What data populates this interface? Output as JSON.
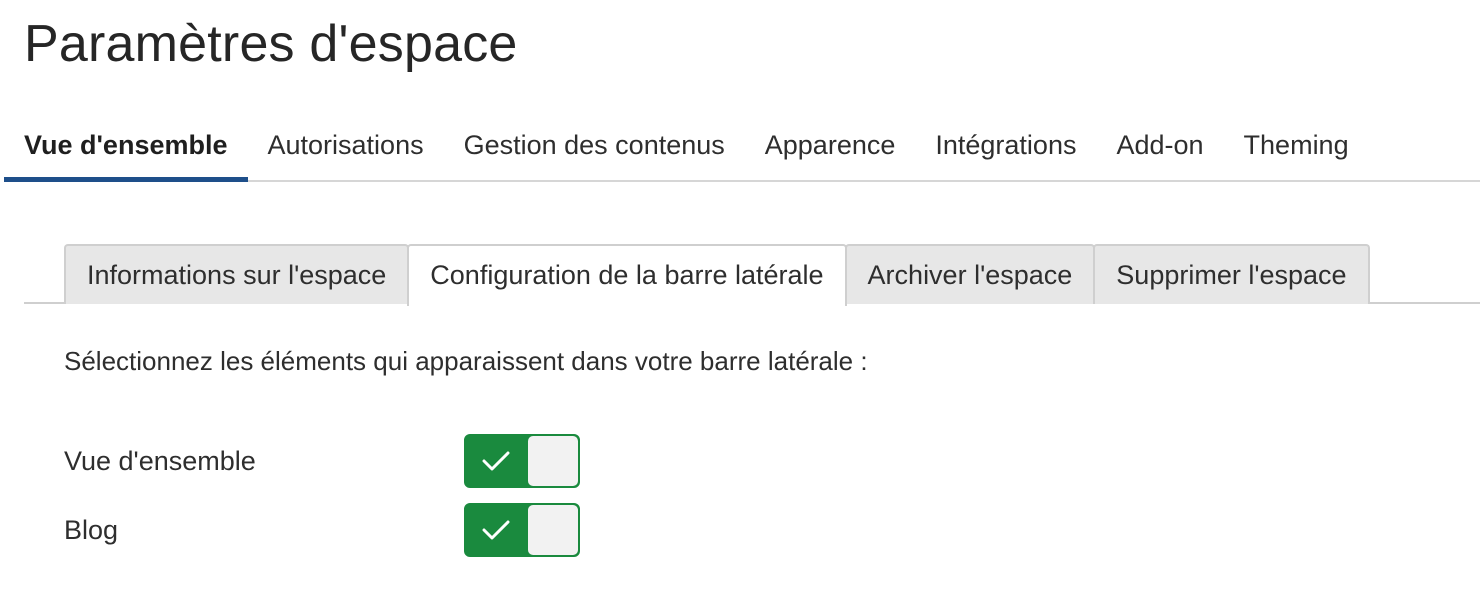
{
  "page": {
    "title": "Paramètres d'espace"
  },
  "top_tabs": [
    {
      "label": "Vue d'ensemble",
      "active": true
    },
    {
      "label": "Autorisations",
      "active": false
    },
    {
      "label": "Gestion des contenus",
      "active": false
    },
    {
      "label": "Apparence",
      "active": false
    },
    {
      "label": "Intégrations",
      "active": false
    },
    {
      "label": "Add-on",
      "active": false
    },
    {
      "label": "Theming",
      "active": false
    }
  ],
  "sub_tabs": [
    {
      "label": "Informations sur l'espace",
      "active": false
    },
    {
      "label": "Configuration de la barre latérale",
      "active": true
    },
    {
      "label": "Archiver l'espace",
      "active": false
    },
    {
      "label": "Supprimer l'espace",
      "active": false
    }
  ],
  "sidebar_config": {
    "instructions": "Sélectionnez les éléments qui apparaissent dans votre barre latérale :",
    "items": [
      {
        "label": "Vue d'ensemble",
        "enabled": true,
        "icon": "check-icon"
      },
      {
        "label": "Blog",
        "enabled": true,
        "icon": "check-icon"
      }
    ]
  },
  "colors": {
    "active_tab_underline": "#1e4f8a",
    "toggle_on": "#1a8a3e"
  }
}
